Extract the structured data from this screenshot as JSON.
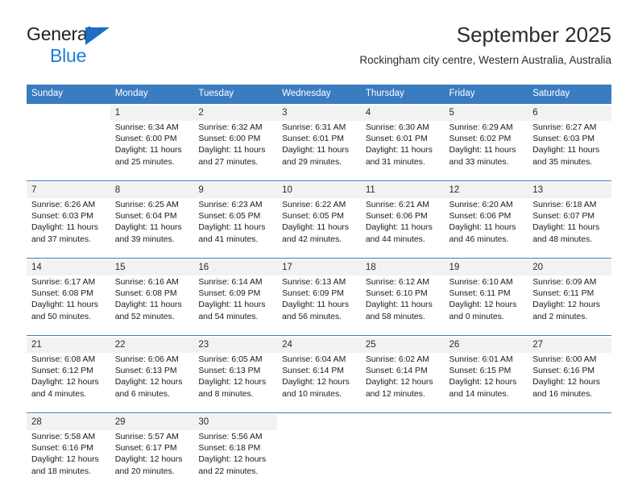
{
  "brand": {
    "name_top": "General",
    "name_bottom": "Blue",
    "accent_color": "#1b7fd4"
  },
  "header": {
    "title": "September 2025",
    "subtitle": "Rockingham city centre, Western Australia, Australia"
  },
  "theme": {
    "header_bg": "#3a7cc0",
    "daynum_bg": "#f2f2f2",
    "text": "#1a1a1a"
  },
  "weekday_headers": [
    "Sunday",
    "Monday",
    "Tuesday",
    "Wednesday",
    "Thursday",
    "Friday",
    "Saturday"
  ],
  "weeks": [
    [
      {
        "day": "",
        "lines": []
      },
      {
        "day": "1",
        "lines": [
          "Sunrise: 6:34 AM",
          "Sunset: 6:00 PM",
          "Daylight: 11 hours",
          "and 25 minutes."
        ]
      },
      {
        "day": "2",
        "lines": [
          "Sunrise: 6:32 AM",
          "Sunset: 6:00 PM",
          "Daylight: 11 hours",
          "and 27 minutes."
        ]
      },
      {
        "day": "3",
        "lines": [
          "Sunrise: 6:31 AM",
          "Sunset: 6:01 PM",
          "Daylight: 11 hours",
          "and 29 minutes."
        ]
      },
      {
        "day": "4",
        "lines": [
          "Sunrise: 6:30 AM",
          "Sunset: 6:01 PM",
          "Daylight: 11 hours",
          "and 31 minutes."
        ]
      },
      {
        "day": "5",
        "lines": [
          "Sunrise: 6:29 AM",
          "Sunset: 6:02 PM",
          "Daylight: 11 hours",
          "and 33 minutes."
        ]
      },
      {
        "day": "6",
        "lines": [
          "Sunrise: 6:27 AM",
          "Sunset: 6:03 PM",
          "Daylight: 11 hours",
          "and 35 minutes."
        ]
      }
    ],
    [
      {
        "day": "7",
        "lines": [
          "Sunrise: 6:26 AM",
          "Sunset: 6:03 PM",
          "Daylight: 11 hours",
          "and 37 minutes."
        ]
      },
      {
        "day": "8",
        "lines": [
          "Sunrise: 6:25 AM",
          "Sunset: 6:04 PM",
          "Daylight: 11 hours",
          "and 39 minutes."
        ]
      },
      {
        "day": "9",
        "lines": [
          "Sunrise: 6:23 AM",
          "Sunset: 6:05 PM",
          "Daylight: 11 hours",
          "and 41 minutes."
        ]
      },
      {
        "day": "10",
        "lines": [
          "Sunrise: 6:22 AM",
          "Sunset: 6:05 PM",
          "Daylight: 11 hours",
          "and 42 minutes."
        ]
      },
      {
        "day": "11",
        "lines": [
          "Sunrise: 6:21 AM",
          "Sunset: 6:06 PM",
          "Daylight: 11 hours",
          "and 44 minutes."
        ]
      },
      {
        "day": "12",
        "lines": [
          "Sunrise: 6:20 AM",
          "Sunset: 6:06 PM",
          "Daylight: 11 hours",
          "and 46 minutes."
        ]
      },
      {
        "day": "13",
        "lines": [
          "Sunrise: 6:18 AM",
          "Sunset: 6:07 PM",
          "Daylight: 11 hours",
          "and 48 minutes."
        ]
      }
    ],
    [
      {
        "day": "14",
        "lines": [
          "Sunrise: 6:17 AM",
          "Sunset: 6:08 PM",
          "Daylight: 11 hours",
          "and 50 minutes."
        ]
      },
      {
        "day": "15",
        "lines": [
          "Sunrise: 6:16 AM",
          "Sunset: 6:08 PM",
          "Daylight: 11 hours",
          "and 52 minutes."
        ]
      },
      {
        "day": "16",
        "lines": [
          "Sunrise: 6:14 AM",
          "Sunset: 6:09 PM",
          "Daylight: 11 hours",
          "and 54 minutes."
        ]
      },
      {
        "day": "17",
        "lines": [
          "Sunrise: 6:13 AM",
          "Sunset: 6:09 PM",
          "Daylight: 11 hours",
          "and 56 minutes."
        ]
      },
      {
        "day": "18",
        "lines": [
          "Sunrise: 6:12 AM",
          "Sunset: 6:10 PM",
          "Daylight: 11 hours",
          "and 58 minutes."
        ]
      },
      {
        "day": "19",
        "lines": [
          "Sunrise: 6:10 AM",
          "Sunset: 6:11 PM",
          "Daylight: 12 hours",
          "and 0 minutes."
        ]
      },
      {
        "day": "20",
        "lines": [
          "Sunrise: 6:09 AM",
          "Sunset: 6:11 PM",
          "Daylight: 12 hours",
          "and 2 minutes."
        ]
      }
    ],
    [
      {
        "day": "21",
        "lines": [
          "Sunrise: 6:08 AM",
          "Sunset: 6:12 PM",
          "Daylight: 12 hours",
          "and 4 minutes."
        ]
      },
      {
        "day": "22",
        "lines": [
          "Sunrise: 6:06 AM",
          "Sunset: 6:13 PM",
          "Daylight: 12 hours",
          "and 6 minutes."
        ]
      },
      {
        "day": "23",
        "lines": [
          "Sunrise: 6:05 AM",
          "Sunset: 6:13 PM",
          "Daylight: 12 hours",
          "and 8 minutes."
        ]
      },
      {
        "day": "24",
        "lines": [
          "Sunrise: 6:04 AM",
          "Sunset: 6:14 PM",
          "Daylight: 12 hours",
          "and 10 minutes."
        ]
      },
      {
        "day": "25",
        "lines": [
          "Sunrise: 6:02 AM",
          "Sunset: 6:14 PM",
          "Daylight: 12 hours",
          "and 12 minutes."
        ]
      },
      {
        "day": "26",
        "lines": [
          "Sunrise: 6:01 AM",
          "Sunset: 6:15 PM",
          "Daylight: 12 hours",
          "and 14 minutes."
        ]
      },
      {
        "day": "27",
        "lines": [
          "Sunrise: 6:00 AM",
          "Sunset: 6:16 PM",
          "Daylight: 12 hours",
          "and 16 minutes."
        ]
      }
    ],
    [
      {
        "day": "28",
        "lines": [
          "Sunrise: 5:58 AM",
          "Sunset: 6:16 PM",
          "Daylight: 12 hours",
          "and 18 minutes."
        ]
      },
      {
        "day": "29",
        "lines": [
          "Sunrise: 5:57 AM",
          "Sunset: 6:17 PM",
          "Daylight: 12 hours",
          "and 20 minutes."
        ]
      },
      {
        "day": "30",
        "lines": [
          "Sunrise: 5:56 AM",
          "Sunset: 6:18 PM",
          "Daylight: 12 hours",
          "and 22 minutes."
        ]
      },
      {
        "day": "",
        "lines": []
      },
      {
        "day": "",
        "lines": []
      },
      {
        "day": "",
        "lines": []
      },
      {
        "day": "",
        "lines": []
      }
    ]
  ]
}
